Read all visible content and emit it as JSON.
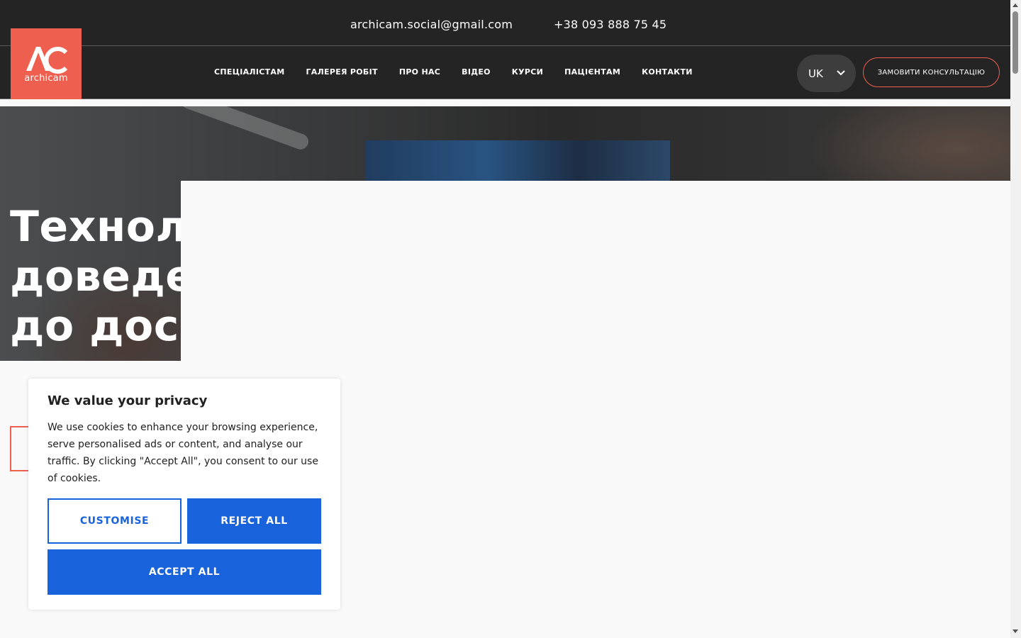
{
  "header": {
    "email": "archicam.social@gmail.com",
    "phone": "+38 093 888 75 45"
  },
  "logo": {
    "mark": "AC",
    "text": "archicam",
    "color": "#ef5f4f"
  },
  "nav": {
    "items": [
      {
        "label": "СПЕЦІАЛІСТАМ"
      },
      {
        "label": "ГАЛЕРЕЯ РОБІТ"
      },
      {
        "label": "ПРО НАС"
      },
      {
        "label": "ВІДЕО"
      },
      {
        "label": "КУРСИ"
      },
      {
        "label": "ПАЦІЄНТАМ"
      },
      {
        "label": "КОНТАКТИ"
      }
    ],
    "language": "UK",
    "language_icon": "chevron-down-icon",
    "consult_button": "ЗАМОВИТИ КОНСУЛЬТАЦІЮ"
  },
  "hero": {
    "title_visible": "Технолс\nдоведе\nдо доск"
  },
  "cookie_banner": {
    "title": "We value your privacy",
    "text": "We use cookies to enhance your browsing experience, serve personalised ads or content, and analyse our traffic. By clicking \"Accept All\", you consent to our use of cookies.",
    "customise": "CUSTOMISE",
    "reject": "REJECT ALL",
    "accept": "ACCEPT ALL",
    "accent_color": "#1863dc"
  },
  "colors": {
    "header_bg": "#242424",
    "brand": "#ef5f4f",
    "page_bg": "#f9f9f9"
  }
}
